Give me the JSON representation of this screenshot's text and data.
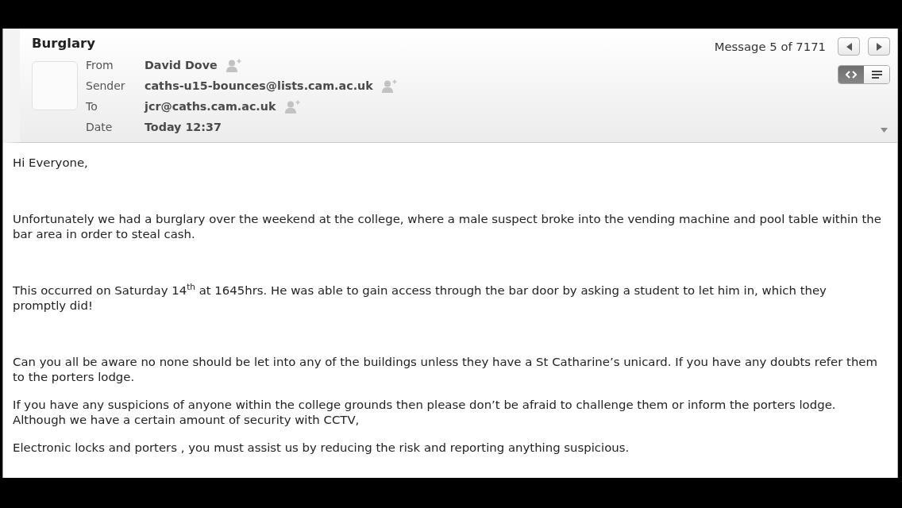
{
  "message": {
    "subject": "Burglary",
    "counter": "Message 5 of 7171",
    "fields": [
      {
        "label": "From",
        "value": "David Dove",
        "kind": "contact"
      },
      {
        "label": "Sender",
        "value": "caths-u15-bounces@lists.cam.ac.uk",
        "kind": "contact"
      },
      {
        "label": "To",
        "value": "jcr@caths.cam.ac.uk",
        "kind": "contact"
      },
      {
        "label": "Date",
        "value": "Today 12:37",
        "kind": "date"
      }
    ],
    "view_modes": [
      {
        "kind": "source",
        "selected": true
      },
      {
        "kind": "plain",
        "selected": false
      }
    ]
  },
  "body": {
    "paragraphs": [
      {
        "kind": "spaced",
        "lines": [
          "Hi Everyone,"
        ]
      },
      {
        "kind": "spaced",
        "lines": [
          "Unfortunately we had a burglary over the weekend at the college, where a male suspect broke into the vending machine and pool table within the",
          "bar area in order to steal cash."
        ]
      },
      {
        "kind": "spaced",
        "lines": [
          "This occurred on Saturday 14$^{th}$ at 1645hrs. He was able to gain access through the bar door by asking a student to let him in, which they",
          "promptly did!"
        ]
      },
      {
        "kind": "plain",
        "lines": [
          "Can you all be aware no none should be let into any of the buildings unless they have a St Catharine’s unicard. If you have any doubts refer them",
          "to the porters lodge."
        ]
      },
      {
        "kind": "plain",
        "lines": [
          "If you have any suspicions of anyone within the college grounds then please don’t be afraid to challenge them or inform the porters lodge.",
          "Although we have a certain amount of security with CCTV,"
        ]
      },
      {
        "kind": "plain",
        "lines": [
          "Electronic locks and porters , you must assist us by reducing the risk and reporting anything suspicious."
        ]
      }
    ]
  }
}
